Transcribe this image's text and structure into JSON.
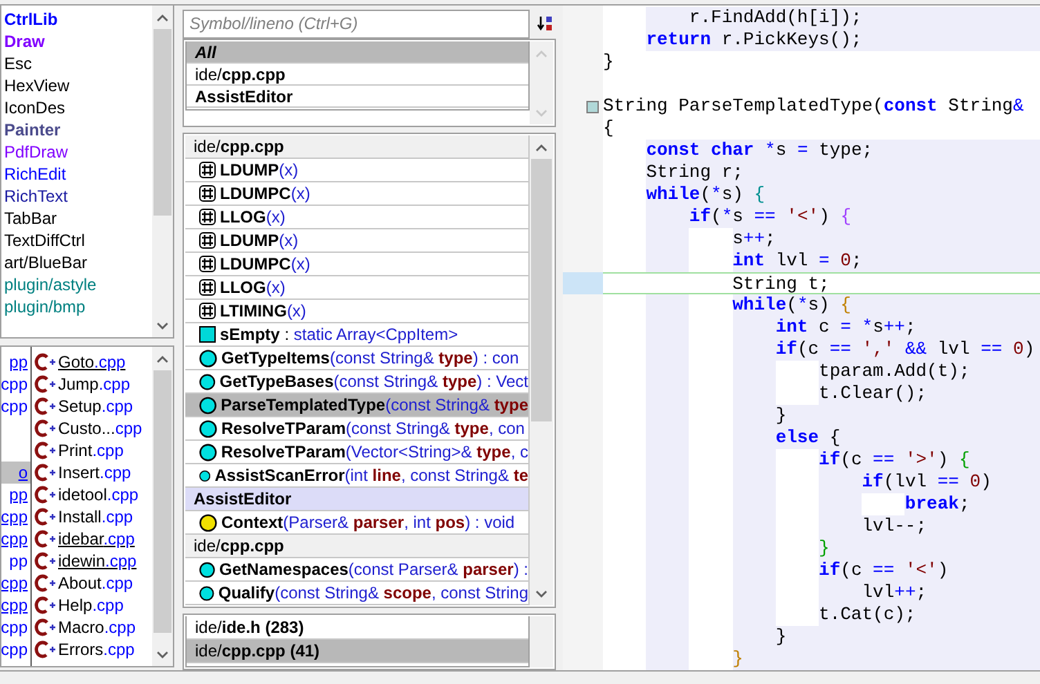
{
  "packages": [
    {
      "name": "CtrlLib",
      "color": "#0000ff",
      "bold": true
    },
    {
      "name": "Draw",
      "color": "#8000ff",
      "bold": true
    },
    {
      "name": "Esc",
      "color": "#000000",
      "bold": false
    },
    {
      "name": "HexView",
      "color": "#000000",
      "bold": false
    },
    {
      "name": "IconDes",
      "color": "#000000",
      "bold": false
    },
    {
      "name": "Painter",
      "color": "#4b4b8c",
      "bold": true
    },
    {
      "name": "PdfDraw",
      "color": "#8000ff",
      "bold": false
    },
    {
      "name": "RichEdit",
      "color": "#0000ff",
      "bold": false
    },
    {
      "name": "RichText",
      "color": "#1a1aa0",
      "bold": false
    },
    {
      "name": "TabBar",
      "color": "#000000",
      "bold": false
    },
    {
      "name": "TextDiffCtrl",
      "color": "#000000",
      "bold": false
    },
    {
      "name": "art/BlueBar",
      "color": "#000000",
      "bold": false
    },
    {
      "name": "plugin/astyle",
      "color": "#008080",
      "bold": false
    },
    {
      "name": "plugin/bmp",
      "color": "#008080",
      "bold": false
    }
  ],
  "files_left": [
    {
      "kind": "file",
      "text": "pp",
      "selected": false,
      "underlined": true
    },
    {
      "kind": "file",
      "text": "cpp",
      "selected": false,
      "underlined": false
    },
    {
      "kind": "file",
      "text": "cpp",
      "selected": false,
      "underlined": false
    },
    {
      "kind": "blank"
    },
    {
      "kind": "blank"
    },
    {
      "kind": "file",
      "text": "o",
      "selected": true,
      "underlined": true
    },
    {
      "kind": "file",
      "text": "pp",
      "selected": false,
      "underlined": true
    },
    {
      "kind": "file",
      "text": "cpp",
      "selected": false,
      "underlined": true
    },
    {
      "kind": "file",
      "text": "cpp",
      "selected": false,
      "underlined": true
    },
    {
      "kind": "file",
      "text": "pp",
      "selected": false,
      "underlined": false
    },
    {
      "kind": "file",
      "text": "cpp",
      "selected": false,
      "underlined": true
    },
    {
      "kind": "file",
      "text": "cpp",
      "selected": false,
      "underlined": true
    },
    {
      "kind": "file",
      "text": "cpp",
      "selected": false,
      "underlined": false
    },
    {
      "kind": "file",
      "text": "cpp",
      "selected": false,
      "underlined": false
    }
  ],
  "files_right": [
    {
      "name": "Goto",
      "ext": ".cpp",
      "underlined": true
    },
    {
      "name": "Jump",
      "ext": ".cpp",
      "underlined": false
    },
    {
      "name": "Setup",
      "ext": ".cpp",
      "underlined": false
    },
    {
      "name": "Custo...",
      "ext": "cpp",
      "underlined": false
    },
    {
      "name": "Print",
      "ext": ".cpp",
      "underlined": false
    },
    {
      "name": "Insert",
      "ext": ".cpp",
      "underlined": false
    },
    {
      "name": "idetool",
      "ext": ".cpp",
      "underlined": false
    },
    {
      "name": "Install",
      "ext": ".cpp",
      "underlined": false
    },
    {
      "name": "idebar",
      "ext": ".cpp",
      "underlined": true
    },
    {
      "name": "idewin",
      "ext": ".cpp",
      "underlined": true
    },
    {
      "name": "About",
      "ext": ".cpp",
      "underlined": false
    },
    {
      "name": "Help",
      "ext": ".cpp",
      "underlined": false
    },
    {
      "name": "Macro",
      "ext": ".cpp",
      "underlined": false
    },
    {
      "name": "Errors",
      "ext": ".cpp",
      "underlined": false
    }
  ],
  "search": {
    "placeholder": "Symbol/lineno (Ctrl+G)"
  },
  "scopes": [
    {
      "parts": [
        {
          "kind": "all",
          "text": "All"
        }
      ],
      "selected": true
    },
    {
      "parts": [
        {
          "kind": "path",
          "text": "ide/"
        },
        {
          "kind": "file",
          "text": "cpp.cpp"
        }
      ],
      "selected": false
    },
    {
      "parts": [
        {
          "kind": "file",
          "text": "AssistEditor"
        }
      ],
      "selected": false
    }
  ],
  "symbols": [
    {
      "kind": "header",
      "selected": false,
      "parts": [
        {
          "kind": "path",
          "text": "ide/"
        },
        {
          "kind": "file",
          "text": "cpp.cpp"
        }
      ]
    },
    {
      "kind": "macro",
      "selected": false,
      "parts": [
        {
          "kind": "name",
          "text": "LDUMP"
        },
        {
          "kind": "sig",
          "text": "(x)"
        }
      ]
    },
    {
      "kind": "macro",
      "selected": false,
      "parts": [
        {
          "kind": "name",
          "text": "LDUMPC"
        },
        {
          "kind": "sig",
          "text": "(x)"
        }
      ]
    },
    {
      "kind": "macro",
      "selected": false,
      "parts": [
        {
          "kind": "name",
          "text": "LLOG"
        },
        {
          "kind": "sig",
          "text": "(x)"
        }
      ]
    },
    {
      "kind": "macro",
      "selected": false,
      "parts": [
        {
          "kind": "name",
          "text": "LDUMP"
        },
        {
          "kind": "sig",
          "text": "(x)"
        }
      ]
    },
    {
      "kind": "macro",
      "selected": false,
      "parts": [
        {
          "kind": "name",
          "text": "LDUMPC"
        },
        {
          "kind": "sig",
          "text": "(x)"
        }
      ]
    },
    {
      "kind": "macro",
      "selected": false,
      "parts": [
        {
          "kind": "name",
          "text": "LLOG"
        },
        {
          "kind": "sig",
          "text": "(x)"
        }
      ]
    },
    {
      "kind": "macro",
      "selected": false,
      "parts": [
        {
          "kind": "name",
          "text": "LTIMING"
        },
        {
          "kind": "sig",
          "text": "(x)"
        }
      ]
    },
    {
      "kind": "variable",
      "color": "#00d8d8",
      "selected": false,
      "parts": [
        {
          "kind": "name",
          "text": "sEmpty"
        },
        {
          "kind": "plain",
          "text": " : "
        },
        {
          "kind": "sig",
          "text": "static Array<CppItem>"
        }
      ]
    },
    {
      "kind": "function",
      "color": "#00e0e0",
      "selected": false,
      "parts": [
        {
          "kind": "name",
          "text": "GetTypeItems"
        },
        {
          "kind": "sig",
          "text": "(const String& "
        },
        {
          "kind": "arg",
          "text": "type"
        },
        {
          "kind": "sig",
          "text": ") : con"
        }
      ]
    },
    {
      "kind": "function",
      "color": "#00e0e0",
      "selected": false,
      "parts": [
        {
          "kind": "name",
          "text": "GetTypeBases"
        },
        {
          "kind": "sig",
          "text": "(const String& "
        },
        {
          "kind": "arg",
          "text": "type"
        },
        {
          "kind": "sig",
          "text": ") : Vect"
        }
      ]
    },
    {
      "kind": "function",
      "color": "#00e0e0",
      "selected": true,
      "parts": [
        {
          "kind": "name",
          "text": "ParseTemplatedType"
        },
        {
          "kind": "sig",
          "text": "(const String& "
        },
        {
          "kind": "arg",
          "text": "type"
        }
      ]
    },
    {
      "kind": "function",
      "color": "#00e0e0",
      "selected": false,
      "parts": [
        {
          "kind": "name",
          "text": "ResolveTParam"
        },
        {
          "kind": "sig",
          "text": "(const String& "
        },
        {
          "kind": "arg",
          "text": "type"
        },
        {
          "kind": "sig",
          "text": ", con"
        }
      ]
    },
    {
      "kind": "function",
      "color": "#00e0e0",
      "selected": false,
      "parts": [
        {
          "kind": "name",
          "text": "ResolveTParam"
        },
        {
          "kind": "sig",
          "text": "(Vector<String>& "
        },
        {
          "kind": "arg",
          "text": "type"
        },
        {
          "kind": "sig",
          "text": ", c"
        }
      ]
    },
    {
      "kind": "function",
      "color": "#00e0e0",
      "selected": false,
      "parts": [
        {
          "kind": "name",
          "text": "AssistScanError"
        },
        {
          "kind": "sig",
          "text": "(int "
        },
        {
          "kind": "arg",
          "text": "line"
        },
        {
          "kind": "sig",
          "text": ", const String& "
        },
        {
          "kind": "arg",
          "text": "te"
        }
      ]
    },
    {
      "kind": "group",
      "selected": false,
      "parts": [
        {
          "kind": "file",
          "text": "AssistEditor"
        }
      ]
    },
    {
      "kind": "function",
      "color": "#f0e000",
      "selected": false,
      "parts": [
        {
          "kind": "name",
          "text": "Context"
        },
        {
          "kind": "sig",
          "text": "(Parser& "
        },
        {
          "kind": "arg",
          "text": "parser"
        },
        {
          "kind": "sig",
          "text": ", int "
        },
        {
          "kind": "arg",
          "text": "pos"
        },
        {
          "kind": "sig",
          "text": ") : void"
        }
      ]
    },
    {
      "kind": "header",
      "selected": false,
      "parts": [
        {
          "kind": "path",
          "text": "ide/"
        },
        {
          "kind": "file",
          "text": "cpp.cpp"
        }
      ]
    },
    {
      "kind": "function",
      "color": "#00e0e0",
      "selected": false,
      "parts": [
        {
          "kind": "name",
          "text": "GetNamespaces"
        },
        {
          "kind": "sig",
          "text": "(const Parser& "
        },
        {
          "kind": "arg",
          "text": "parser"
        },
        {
          "kind": "sig",
          "text": ") :"
        }
      ]
    },
    {
      "kind": "function",
      "color": "#00e0e0",
      "selected": false,
      "parts": [
        {
          "kind": "name",
          "text": "Qualify"
        },
        {
          "kind": "sig",
          "text": "(const String& "
        },
        {
          "kind": "arg",
          "text": "scope"
        },
        {
          "kind": "sig",
          "text": ", const String"
        }
      ]
    }
  ],
  "references": [
    {
      "parts": [
        {
          "kind": "path",
          "text": "ide/"
        },
        {
          "kind": "file",
          "text": "ide.h (283)"
        }
      ],
      "selected": false
    },
    {
      "parts": [
        {
          "kind": "path",
          "text": "ide/"
        },
        {
          "kind": "file",
          "text": "cpp.cpp (41)"
        }
      ],
      "selected": true
    }
  ],
  "code": [
    {
      "kind": "code",
      "current": false,
      "fold": false,
      "parts": [
        {
          "kind": "plain",
          "text": "        r.FindAdd(h[i]);"
        }
      ]
    },
    {
      "kind": "code",
      "current": false,
      "fold": false,
      "parts": [
        {
          "kind": "kw",
          "text": "    return"
        },
        {
          "kind": "plain",
          "text": " r.PickKeys();"
        }
      ]
    },
    {
      "kind": "code",
      "current": false,
      "fold": false,
      "parts": [
        {
          "kind": "plain",
          "text": "}"
        }
      ]
    },
    {
      "kind": "blank"
    },
    {
      "kind": "code",
      "current": false,
      "fold": true,
      "parts": [
        {
          "kind": "plain",
          "text": "String ParseTemplatedType("
        },
        {
          "kind": "kw",
          "text": "const"
        },
        {
          "kind": "plain",
          "text": " String"
        },
        {
          "kind": "op",
          "text": "&"
        }
      ]
    },
    {
      "kind": "code",
      "current": false,
      "fold": false,
      "parts": [
        {
          "kind": "plain",
          "text": "{"
        }
      ]
    },
    {
      "kind": "code",
      "current": false,
      "fold": false,
      "parts": [
        {
          "kind": "kw",
          "text": "    const"
        },
        {
          "kind": "kw",
          "text": " char"
        },
        {
          "kind": "op",
          "text": " *"
        },
        {
          "kind": "plain",
          "text": "s "
        },
        {
          "kind": "op",
          "text": "="
        },
        {
          "kind": "plain",
          "text": " type;"
        }
      ]
    },
    {
      "kind": "code",
      "current": false,
      "fold": false,
      "parts": [
        {
          "kind": "plain",
          "text": "    String r;"
        }
      ]
    },
    {
      "kind": "code",
      "current": false,
      "fold": false,
      "parts": [
        {
          "kind": "kw",
          "text": "    while"
        },
        {
          "kind": "plain",
          "text": "("
        },
        {
          "kind": "op",
          "text": "*"
        },
        {
          "kind": "plain",
          "text": "s) "
        },
        {
          "kind": "brace",
          "color": "#009090",
          "text": "{"
        }
      ]
    },
    {
      "kind": "code",
      "current": false,
      "fold": false,
      "parts": [
        {
          "kind": "kw",
          "text": "        if"
        },
        {
          "kind": "plain",
          "text": "("
        },
        {
          "kind": "op",
          "text": "*"
        },
        {
          "kind": "plain",
          "text": "s "
        },
        {
          "kind": "op",
          "text": "=="
        },
        {
          "kind": "str",
          "text": " '<'"
        },
        {
          "kind": "plain",
          "text": ") "
        },
        {
          "kind": "brace",
          "color": "#a040ff",
          "text": "{"
        }
      ]
    },
    {
      "kind": "code",
      "current": false,
      "fold": false,
      "parts": [
        {
          "kind": "plain",
          "text": "            s"
        },
        {
          "kind": "op",
          "text": "++"
        },
        {
          "kind": "plain",
          "text": ";"
        }
      ]
    },
    {
      "kind": "code",
      "current": false,
      "fold": false,
      "parts": [
        {
          "kind": "kw",
          "text": "            int"
        },
        {
          "kind": "plain",
          "text": " lvl "
        },
        {
          "kind": "op",
          "text": "="
        },
        {
          "kind": "num",
          "text": " 0"
        },
        {
          "kind": "plain",
          "text": ";"
        }
      ]
    },
    {
      "kind": "code",
      "current": true,
      "fold": false,
      "parts": [
        {
          "kind": "plain",
          "text": "            String t;"
        }
      ]
    },
    {
      "kind": "code",
      "current": false,
      "fold": false,
      "parts": [
        {
          "kind": "kw",
          "text": "            while"
        },
        {
          "kind": "plain",
          "text": "("
        },
        {
          "kind": "op",
          "text": "*"
        },
        {
          "kind": "plain",
          "text": "s) "
        },
        {
          "kind": "brace",
          "color": "#c08000",
          "text": "{"
        }
      ]
    },
    {
      "kind": "code",
      "current": false,
      "fold": false,
      "parts": [
        {
          "kind": "kw",
          "text": "                int"
        },
        {
          "kind": "plain",
          "text": " c "
        },
        {
          "kind": "op",
          "text": "="
        },
        {
          "kind": "op",
          "text": " *"
        },
        {
          "kind": "plain",
          "text": "s"
        },
        {
          "kind": "op",
          "text": "++"
        },
        {
          "kind": "plain",
          "text": ";"
        }
      ]
    },
    {
      "kind": "code",
      "current": false,
      "fold": false,
      "parts": [
        {
          "kind": "kw",
          "text": "                if"
        },
        {
          "kind": "plain",
          "text": "(c "
        },
        {
          "kind": "op",
          "text": "=="
        },
        {
          "kind": "str",
          "text": " ','"
        },
        {
          "kind": "op",
          "text": " &&"
        },
        {
          "kind": "plain",
          "text": " lvl "
        },
        {
          "kind": "op",
          "text": "=="
        },
        {
          "kind": "num",
          "text": " 0"
        },
        {
          "kind": "plain",
          "text": ")"
        }
      ]
    },
    {
      "kind": "code",
      "current": false,
      "fold": false,
      "parts": [
        {
          "kind": "plain",
          "text": "                    tparam.Add(t);"
        }
      ]
    },
    {
      "kind": "code",
      "current": false,
      "fold": false,
      "parts": [
        {
          "kind": "plain",
          "text": "                    t.Clear();"
        }
      ]
    },
    {
      "kind": "code",
      "current": false,
      "fold": false,
      "parts": [
        {
          "kind": "plain",
          "text": "                }"
        }
      ]
    },
    {
      "kind": "code",
      "current": false,
      "fold": false,
      "parts": [
        {
          "kind": "kw",
          "text": "                else"
        },
        {
          "kind": "plain",
          "text": " {"
        }
      ]
    },
    {
      "kind": "code",
      "current": false,
      "fold": false,
      "parts": [
        {
          "kind": "kw",
          "text": "                    if"
        },
        {
          "kind": "plain",
          "text": "(c "
        },
        {
          "kind": "op",
          "text": "=="
        },
        {
          "kind": "str",
          "text": " '>'"
        },
        {
          "kind": "plain",
          "text": ") "
        },
        {
          "kind": "brace",
          "color": "#00a000",
          "text": "{"
        }
      ]
    },
    {
      "kind": "code",
      "current": false,
      "fold": false,
      "parts": [
        {
          "kind": "kw",
          "text": "                        if"
        },
        {
          "kind": "plain",
          "text": "(lvl "
        },
        {
          "kind": "op",
          "text": "=="
        },
        {
          "kind": "num",
          "text": " 0"
        },
        {
          "kind": "plain",
          "text": ")"
        }
      ]
    },
    {
      "kind": "code",
      "current": false,
      "fold": false,
      "parts": [
        {
          "kind": "kw",
          "text": "                            break"
        },
        {
          "kind": "plain",
          "text": ";"
        }
      ]
    },
    {
      "kind": "code",
      "current": false,
      "fold": false,
      "parts": [
        {
          "kind": "plain",
          "text": "                        lvl--;"
        }
      ]
    },
    {
      "kind": "code",
      "current": false,
      "fold": false,
      "parts": [
        {
          "kind": "brace",
          "color": "#00a000",
          "text": "                    }"
        }
      ]
    },
    {
      "kind": "code",
      "current": false,
      "fold": false,
      "parts": [
        {
          "kind": "kw",
          "text": "                    if"
        },
        {
          "kind": "plain",
          "text": "(c "
        },
        {
          "kind": "op",
          "text": "=="
        },
        {
          "kind": "str",
          "text": " '<'"
        },
        {
          "kind": "plain",
          "text": ")"
        }
      ]
    },
    {
      "kind": "code",
      "current": false,
      "fold": false,
      "parts": [
        {
          "kind": "plain",
          "text": "                        lvl"
        },
        {
          "kind": "op",
          "text": "++"
        },
        {
          "kind": "plain",
          "text": ";"
        }
      ]
    },
    {
      "kind": "code",
      "current": false,
      "fold": false,
      "parts": [
        {
          "kind": "plain",
          "text": "                    t.Cat(c);"
        }
      ]
    },
    {
      "kind": "code",
      "current": false,
      "fold": false,
      "parts": [
        {
          "kind": "plain",
          "text": "                }"
        }
      ]
    },
    {
      "kind": "code",
      "current": false,
      "fold": false,
      "parts": [
        {
          "kind": "brace",
          "color": "#c08000",
          "text": "            }"
        }
      ]
    }
  ]
}
